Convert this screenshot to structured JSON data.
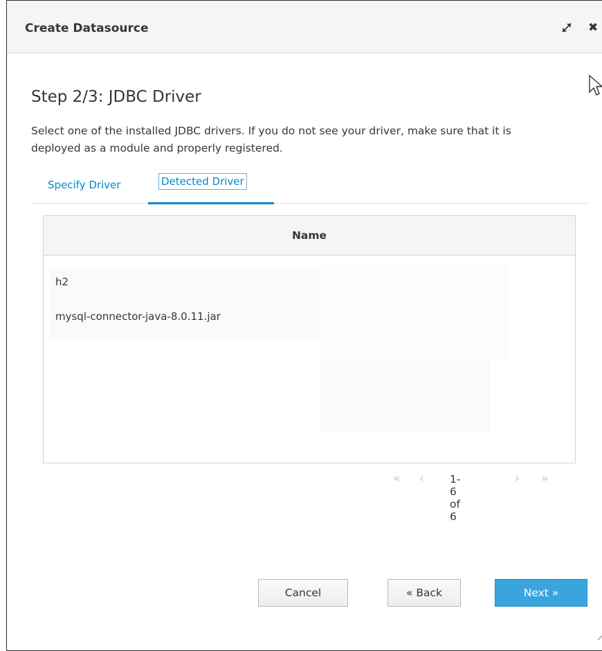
{
  "dialog": {
    "title": "Create Datasource",
    "icons": {
      "maximize": "maximize-icon",
      "close": "close-icon"
    },
    "close_glyph": "✖"
  },
  "step": {
    "title": "Step 2/3: JDBC Driver",
    "description": "Select one of the installed JDBC drivers. If you do not see your driver, make sure that it is deployed as a module and properly registered."
  },
  "tabs": [
    {
      "label": "Specify Driver",
      "active": false
    },
    {
      "label": "Detected Driver",
      "active": true
    }
  ],
  "table": {
    "header": "Name",
    "rows": [
      "h2",
      "mysql-connector-java-8.0.11.jar"
    ]
  },
  "pager": {
    "first": "«",
    "prev": "‹",
    "count": "1-6 of 6",
    "next": "›",
    "last": "»"
  },
  "buttons": {
    "cancel": "Cancel",
    "back": "« Back",
    "next": "Next »"
  },
  "colors": {
    "accent": "#0088ce",
    "primary_button": "#39a5dc",
    "header_bg": "#f5f5f5"
  }
}
